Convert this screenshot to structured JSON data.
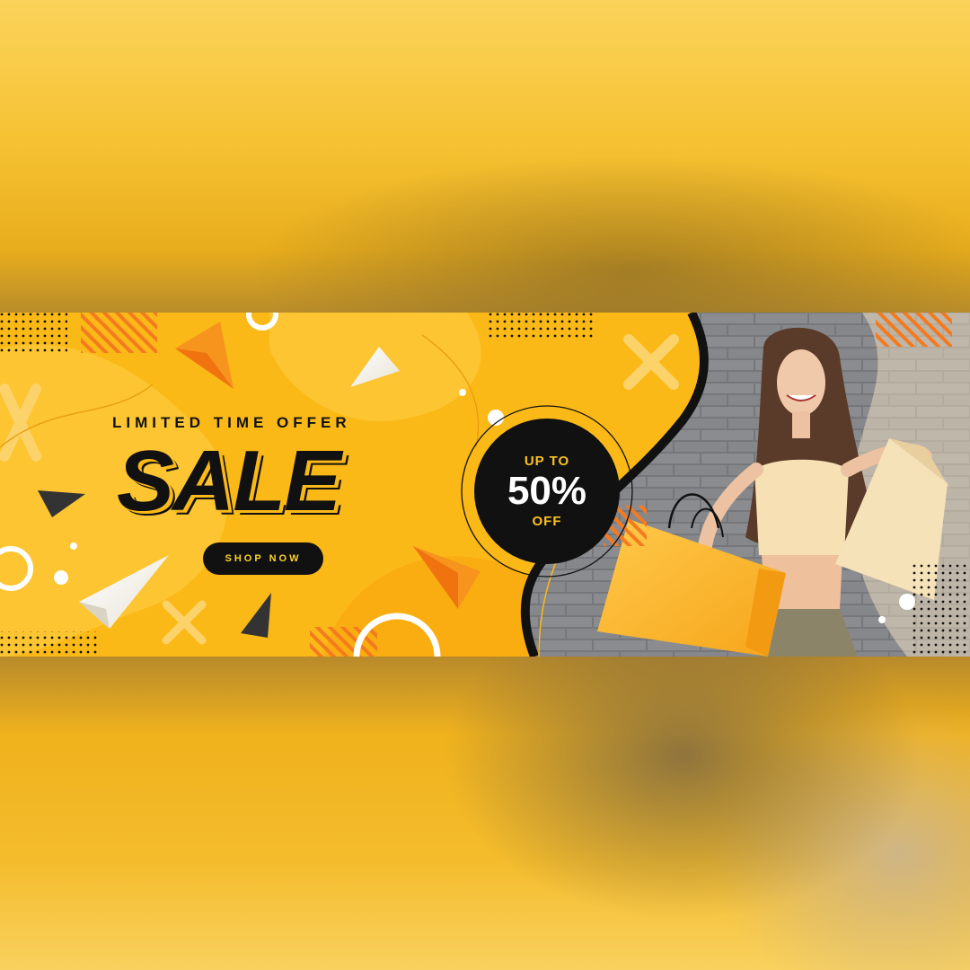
{
  "banner": {
    "eyebrow": "LIMITED TIME OFFER",
    "title": "SALE",
    "cta_label": "SHOP NOW",
    "badge": {
      "prefix": "UP TO",
      "value": "50%",
      "suffix": "OFF"
    }
  },
  "colors": {
    "primary_yellow": "#fbb917",
    "accent_orange": "#f7941d",
    "dark": "#111111",
    "wall_gray": "#7d7f83"
  }
}
